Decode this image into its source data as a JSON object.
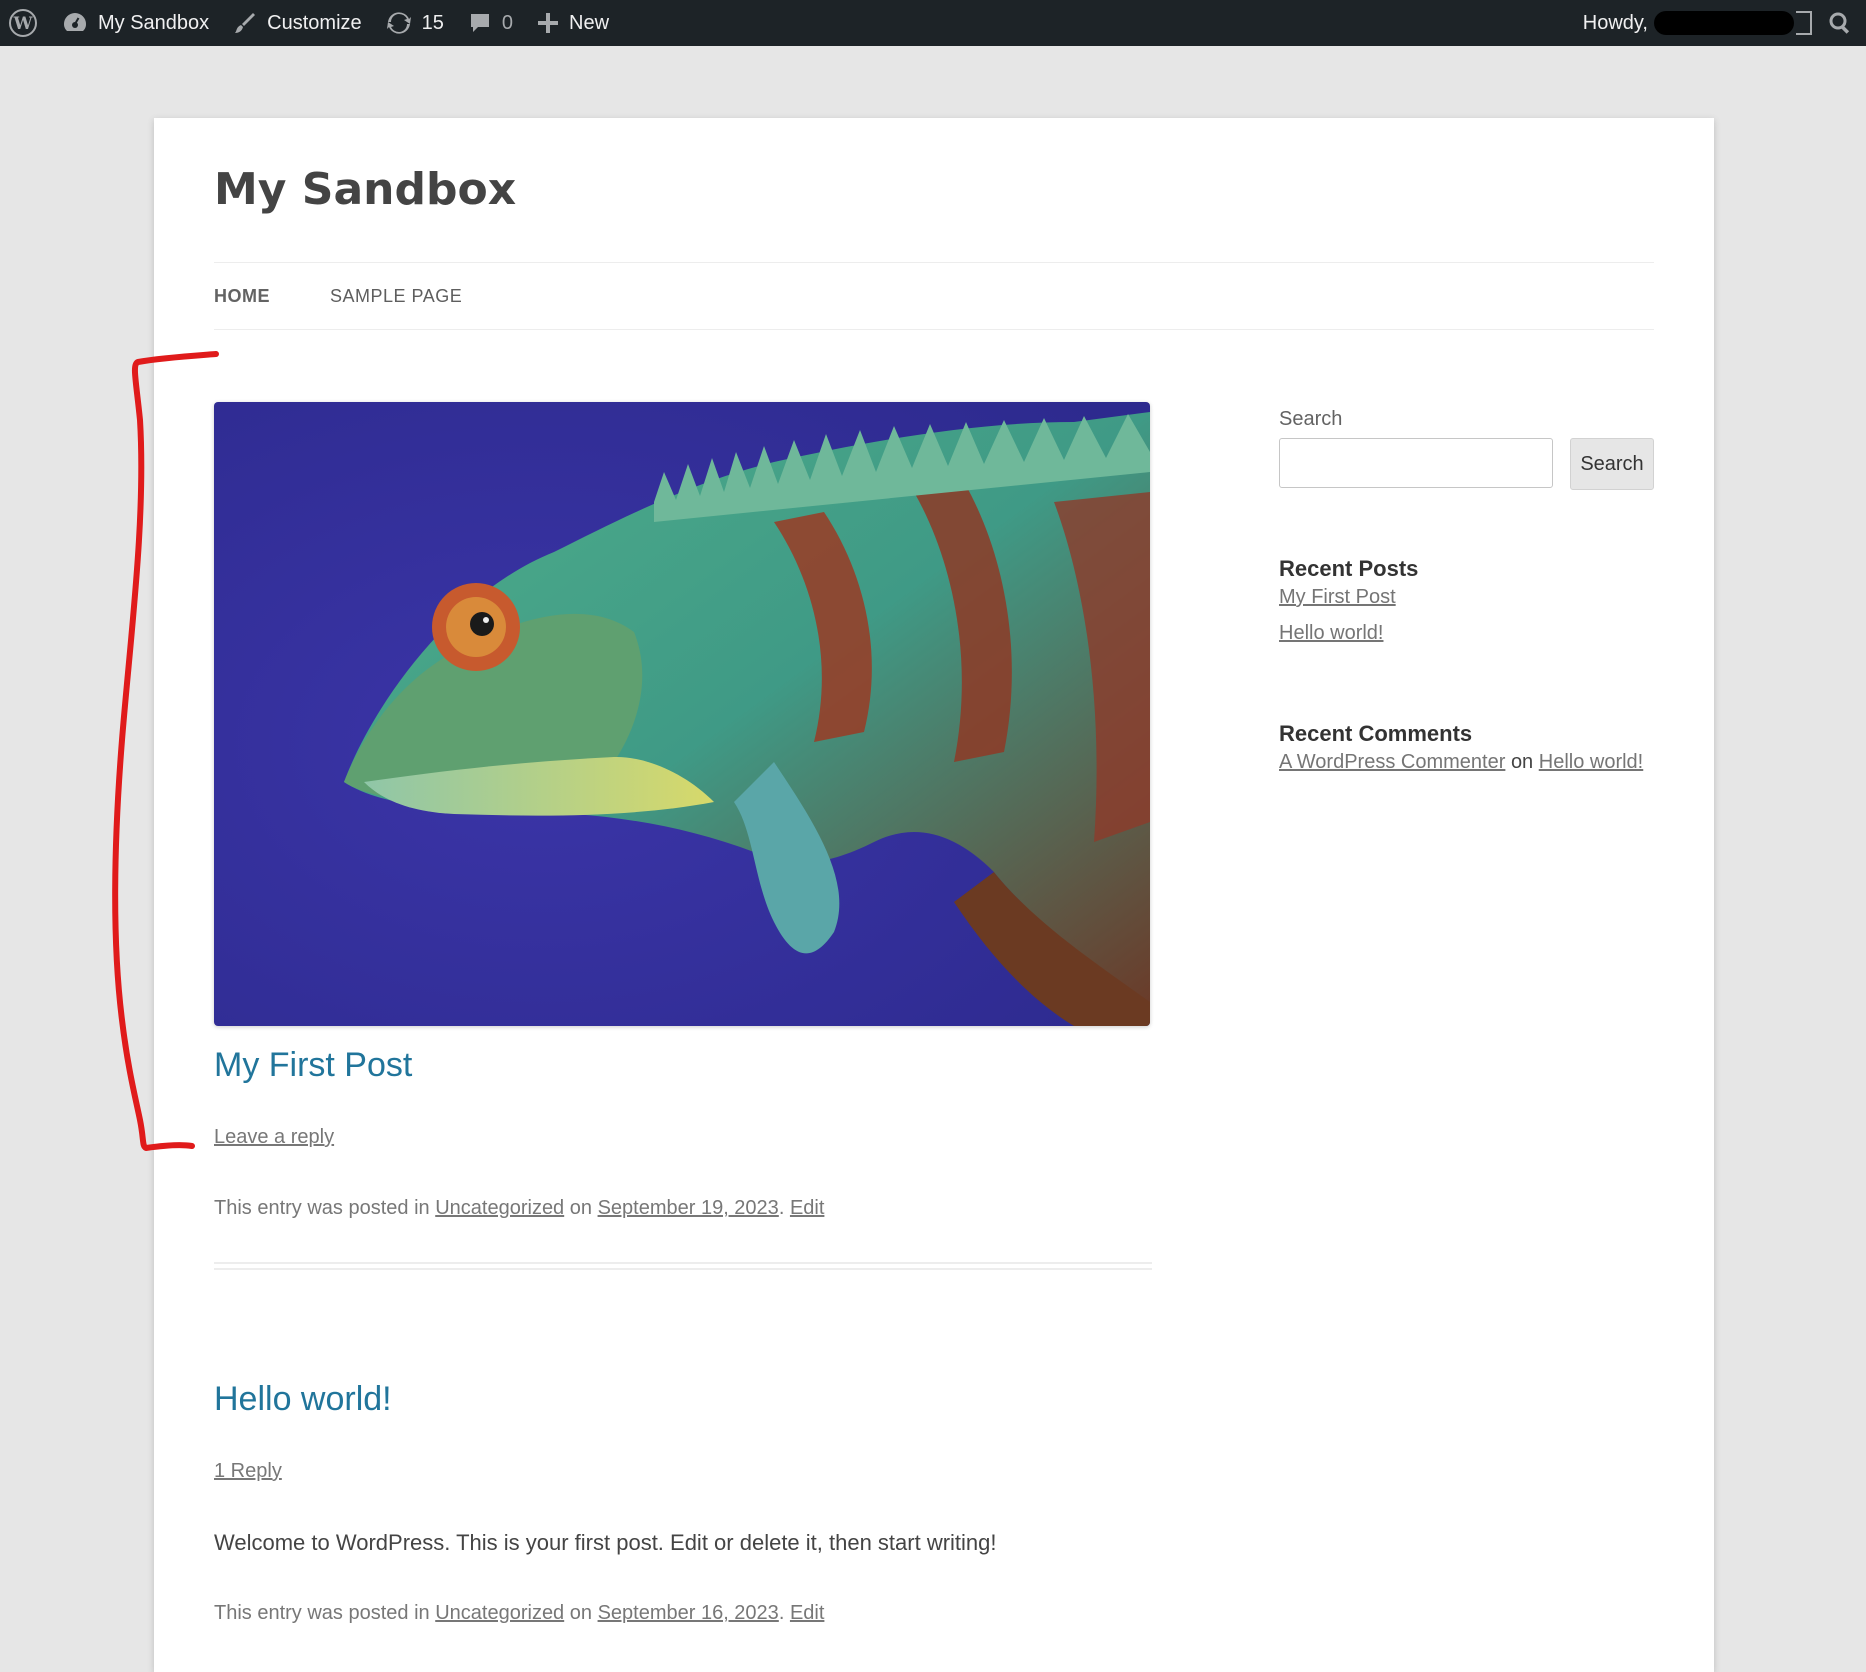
{
  "admin_bar": {
    "site_name": "My Sandbox",
    "customize": "Customize",
    "updates_count": "15",
    "comments_count": "0",
    "new_label": "New",
    "howdy": "Howdy,"
  },
  "site": {
    "title": "My Sandbox",
    "nav": [
      "HOME",
      "SAMPLE PAGE"
    ]
  },
  "posts": [
    {
      "title": "My First Post",
      "comments_link": "Leave a reply",
      "meta_prefix": "This entry was posted in",
      "category": "Uncategorized",
      "on": "on",
      "date": "September 19, 2023",
      "edit": "Edit"
    },
    {
      "title": "Hello world!",
      "comments_link": "1 Reply",
      "content": "Welcome to WordPress. This is your first post. Edit or delete it, then start writing!",
      "meta_prefix": "This entry was posted in",
      "category": "Uncategorized",
      "on": "on",
      "date": "September 16, 2023",
      "edit": "Edit"
    }
  ],
  "sidebar": {
    "search_label": "Search",
    "search_button": "Search",
    "recent_posts_title": "Recent Posts",
    "recent_posts": [
      "My First Post",
      "Hello world!"
    ],
    "recent_comments_title": "Recent Comments",
    "recent_comment": {
      "author": "A WordPress Commenter",
      "on": "on",
      "post": "Hello world!"
    }
  },
  "colors": {
    "admin_bar_bg": "#1d2327",
    "link_blue": "#21759b",
    "annotation_red": "#e01b1b"
  }
}
